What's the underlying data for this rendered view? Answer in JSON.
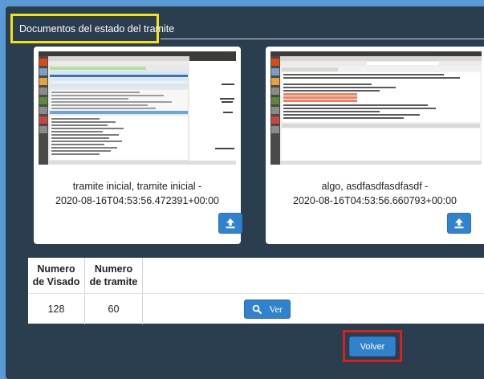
{
  "section": {
    "title": "Documentos del estado del tramite"
  },
  "documents": [
    {
      "caption_line1": "tramite inicial, tramite inicial -",
      "caption_line2": "2020-08-16T04:53:56.472391+00:00",
      "icon": "upload-icon"
    },
    {
      "caption_line1": "algo, asdfasdfasdfasdf -",
      "caption_line2": "2020-08-16T04:53:56.660793+00:00",
      "icon": "upload-icon"
    }
  ],
  "table": {
    "headers": [
      {
        "line1": "Numero",
        "line2": "de Visado"
      },
      {
        "line1": "Numero",
        "line2": "de tramite"
      }
    ],
    "rows": [
      {
        "visado": "128",
        "tramite": "60",
        "action_label": "Ver",
        "action_icon": "search-icon"
      }
    ]
  },
  "footer": {
    "back_label": "Volver"
  },
  "colors": {
    "background": "#2b3e50",
    "accent": "#3182ce",
    "highlight_yellow": "#f5e30d",
    "highlight_red": "#d8201f"
  }
}
